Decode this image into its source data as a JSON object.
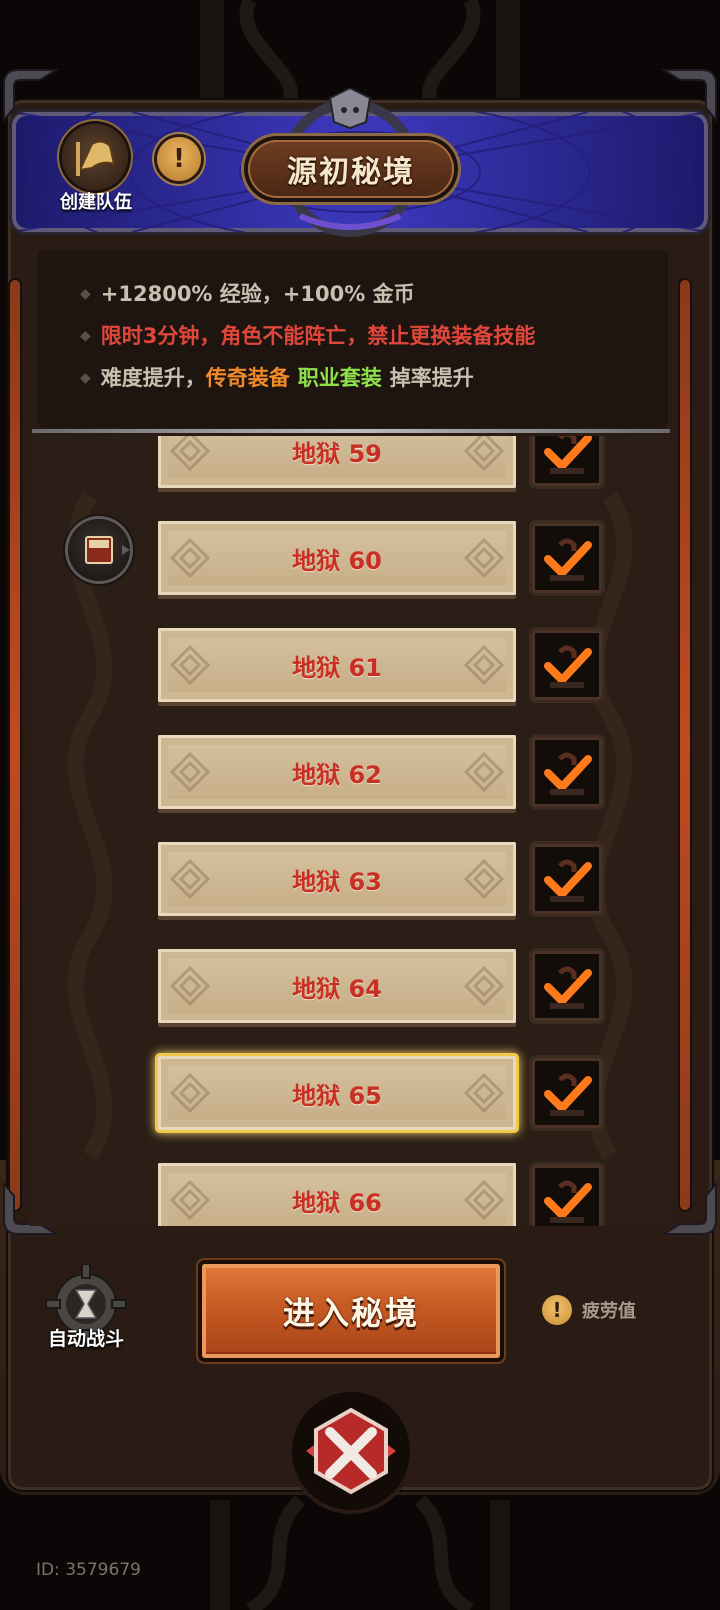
{
  "header": {
    "title": "源初秘境",
    "create_team_label": "创建队伍",
    "info_icon": "exclamation-icon"
  },
  "info": {
    "line1": "+12800% 经验，+100% 金币",
    "line2": "限时3分钟，角色不能阵亡，禁止更换装备技能",
    "line3_prefix": "难度提升，",
    "line3_legendary": "传奇装备",
    "line3_class_set": "职业套装",
    "line3_suffix": "掉率提升"
  },
  "levels": [
    {
      "label": "地狱 59",
      "checked": true,
      "selected": false
    },
    {
      "label": "地狱 60",
      "checked": true,
      "selected": false,
      "current_marker": "book-icon"
    },
    {
      "label": "地狱 61",
      "checked": true,
      "selected": false
    },
    {
      "label": "地狱 62",
      "checked": true,
      "selected": false
    },
    {
      "label": "地狱 63",
      "checked": true,
      "selected": false
    },
    {
      "label": "地狱 64",
      "checked": true,
      "selected": false
    },
    {
      "label": "地狱 65",
      "checked": true,
      "selected": true
    },
    {
      "label": "地狱 66",
      "checked": true,
      "selected": false
    }
  ],
  "footer": {
    "auto_fight_label": "自动战斗",
    "enter_label": "进入秘境",
    "fatigue_label": "疲劳值",
    "user_id": "ID: 3579679"
  },
  "colors": {
    "red_text": "#e0473a",
    "orange_text": "#f08a2a",
    "green_text": "#8fe04a",
    "plate_text": "#c83024",
    "check": "#ff7a1a",
    "selected_glow": "#f2c84a"
  }
}
